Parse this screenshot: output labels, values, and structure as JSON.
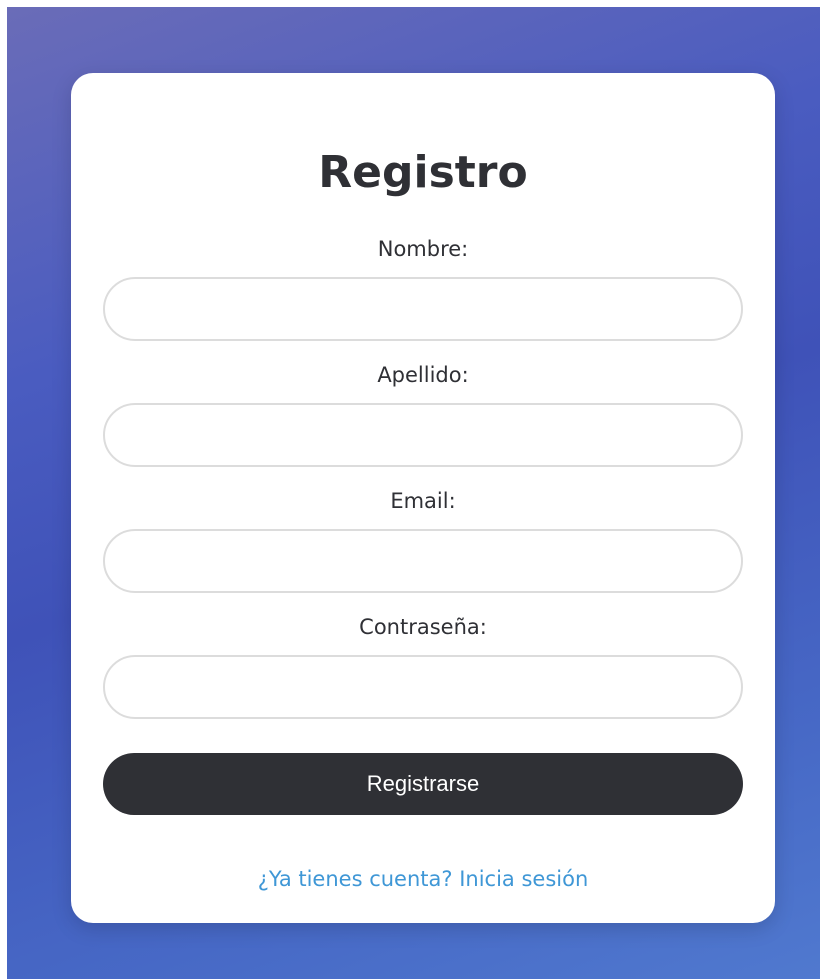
{
  "form": {
    "title": "Registro",
    "fields": [
      {
        "label": "Nombre:",
        "value": "",
        "placeholder": ""
      },
      {
        "label": "Apellido:",
        "value": "",
        "placeholder": ""
      },
      {
        "label": "Email:",
        "value": "",
        "placeholder": ""
      },
      {
        "label": "Contraseña:",
        "value": "",
        "placeholder": ""
      }
    ],
    "submit_label": "Registrarse",
    "login_link": "¿Ya tienes cuenta? Inicia sesión"
  },
  "colors": {
    "accent": "#2f3035",
    "link": "#3f97d6",
    "background_gradient": [
      "#6a6cb8",
      "#3f52b8",
      "#5079cf"
    ]
  }
}
